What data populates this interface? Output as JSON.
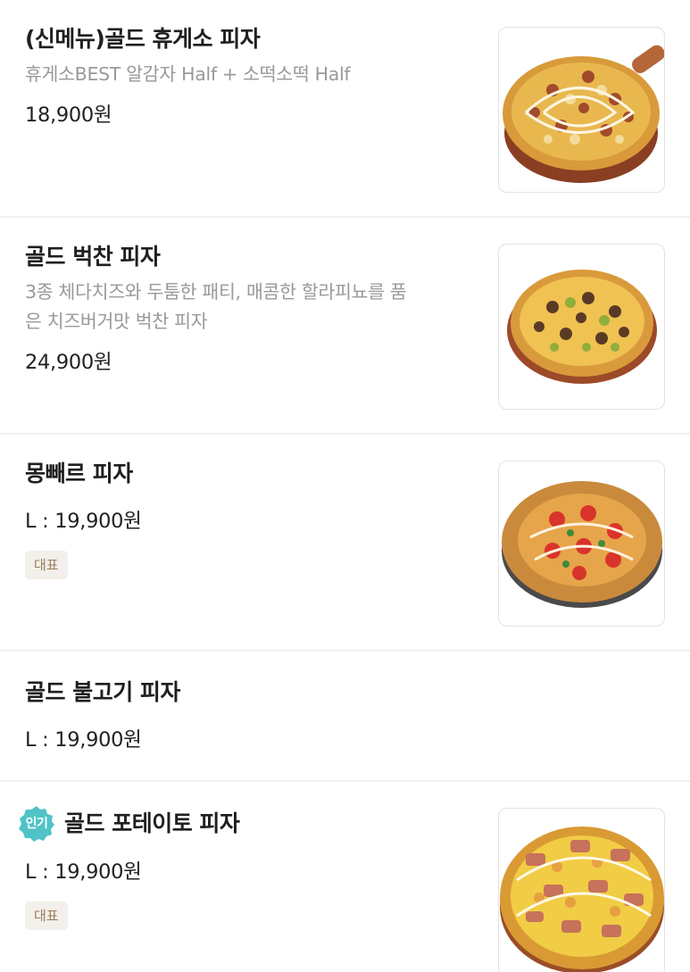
{
  "menu": {
    "items": [
      {
        "name": "(신메뉴)골드 휴게소 피자",
        "description": "휴게소BEST 알감자 Half + 소떡소떡 Half",
        "price": "18,900원",
        "image_icon": "pizza-photo"
      },
      {
        "name": "골드 벅찬 피자",
        "description_line1": "3종 체다치즈와 두툼한 패티, 매콤한 할라피뇨를 품",
        "description_line2": "은 치즈버거맛 벅찬 피자",
        "price": "24,900원",
        "image_icon": "pizza-photo"
      },
      {
        "name": "몽빼르 피자",
        "price": "L : 19,900원",
        "badge": "대표",
        "image_icon": "pizza-photo"
      },
      {
        "name": "골드 불고기 피자",
        "price": "L : 19,900원"
      },
      {
        "popular_badge": "인기",
        "name": "골드 포테이토 피자",
        "price": "L : 19,900원",
        "badge": "대표",
        "image_icon": "pizza-photo"
      }
    ]
  },
  "colors": {
    "divider": "#f1f1f1",
    "rep_badge_bg": "#f3efea",
    "rep_badge_text": "#9c7e5d",
    "popular_badge": "#4fc3c8",
    "description": "#999999"
  }
}
